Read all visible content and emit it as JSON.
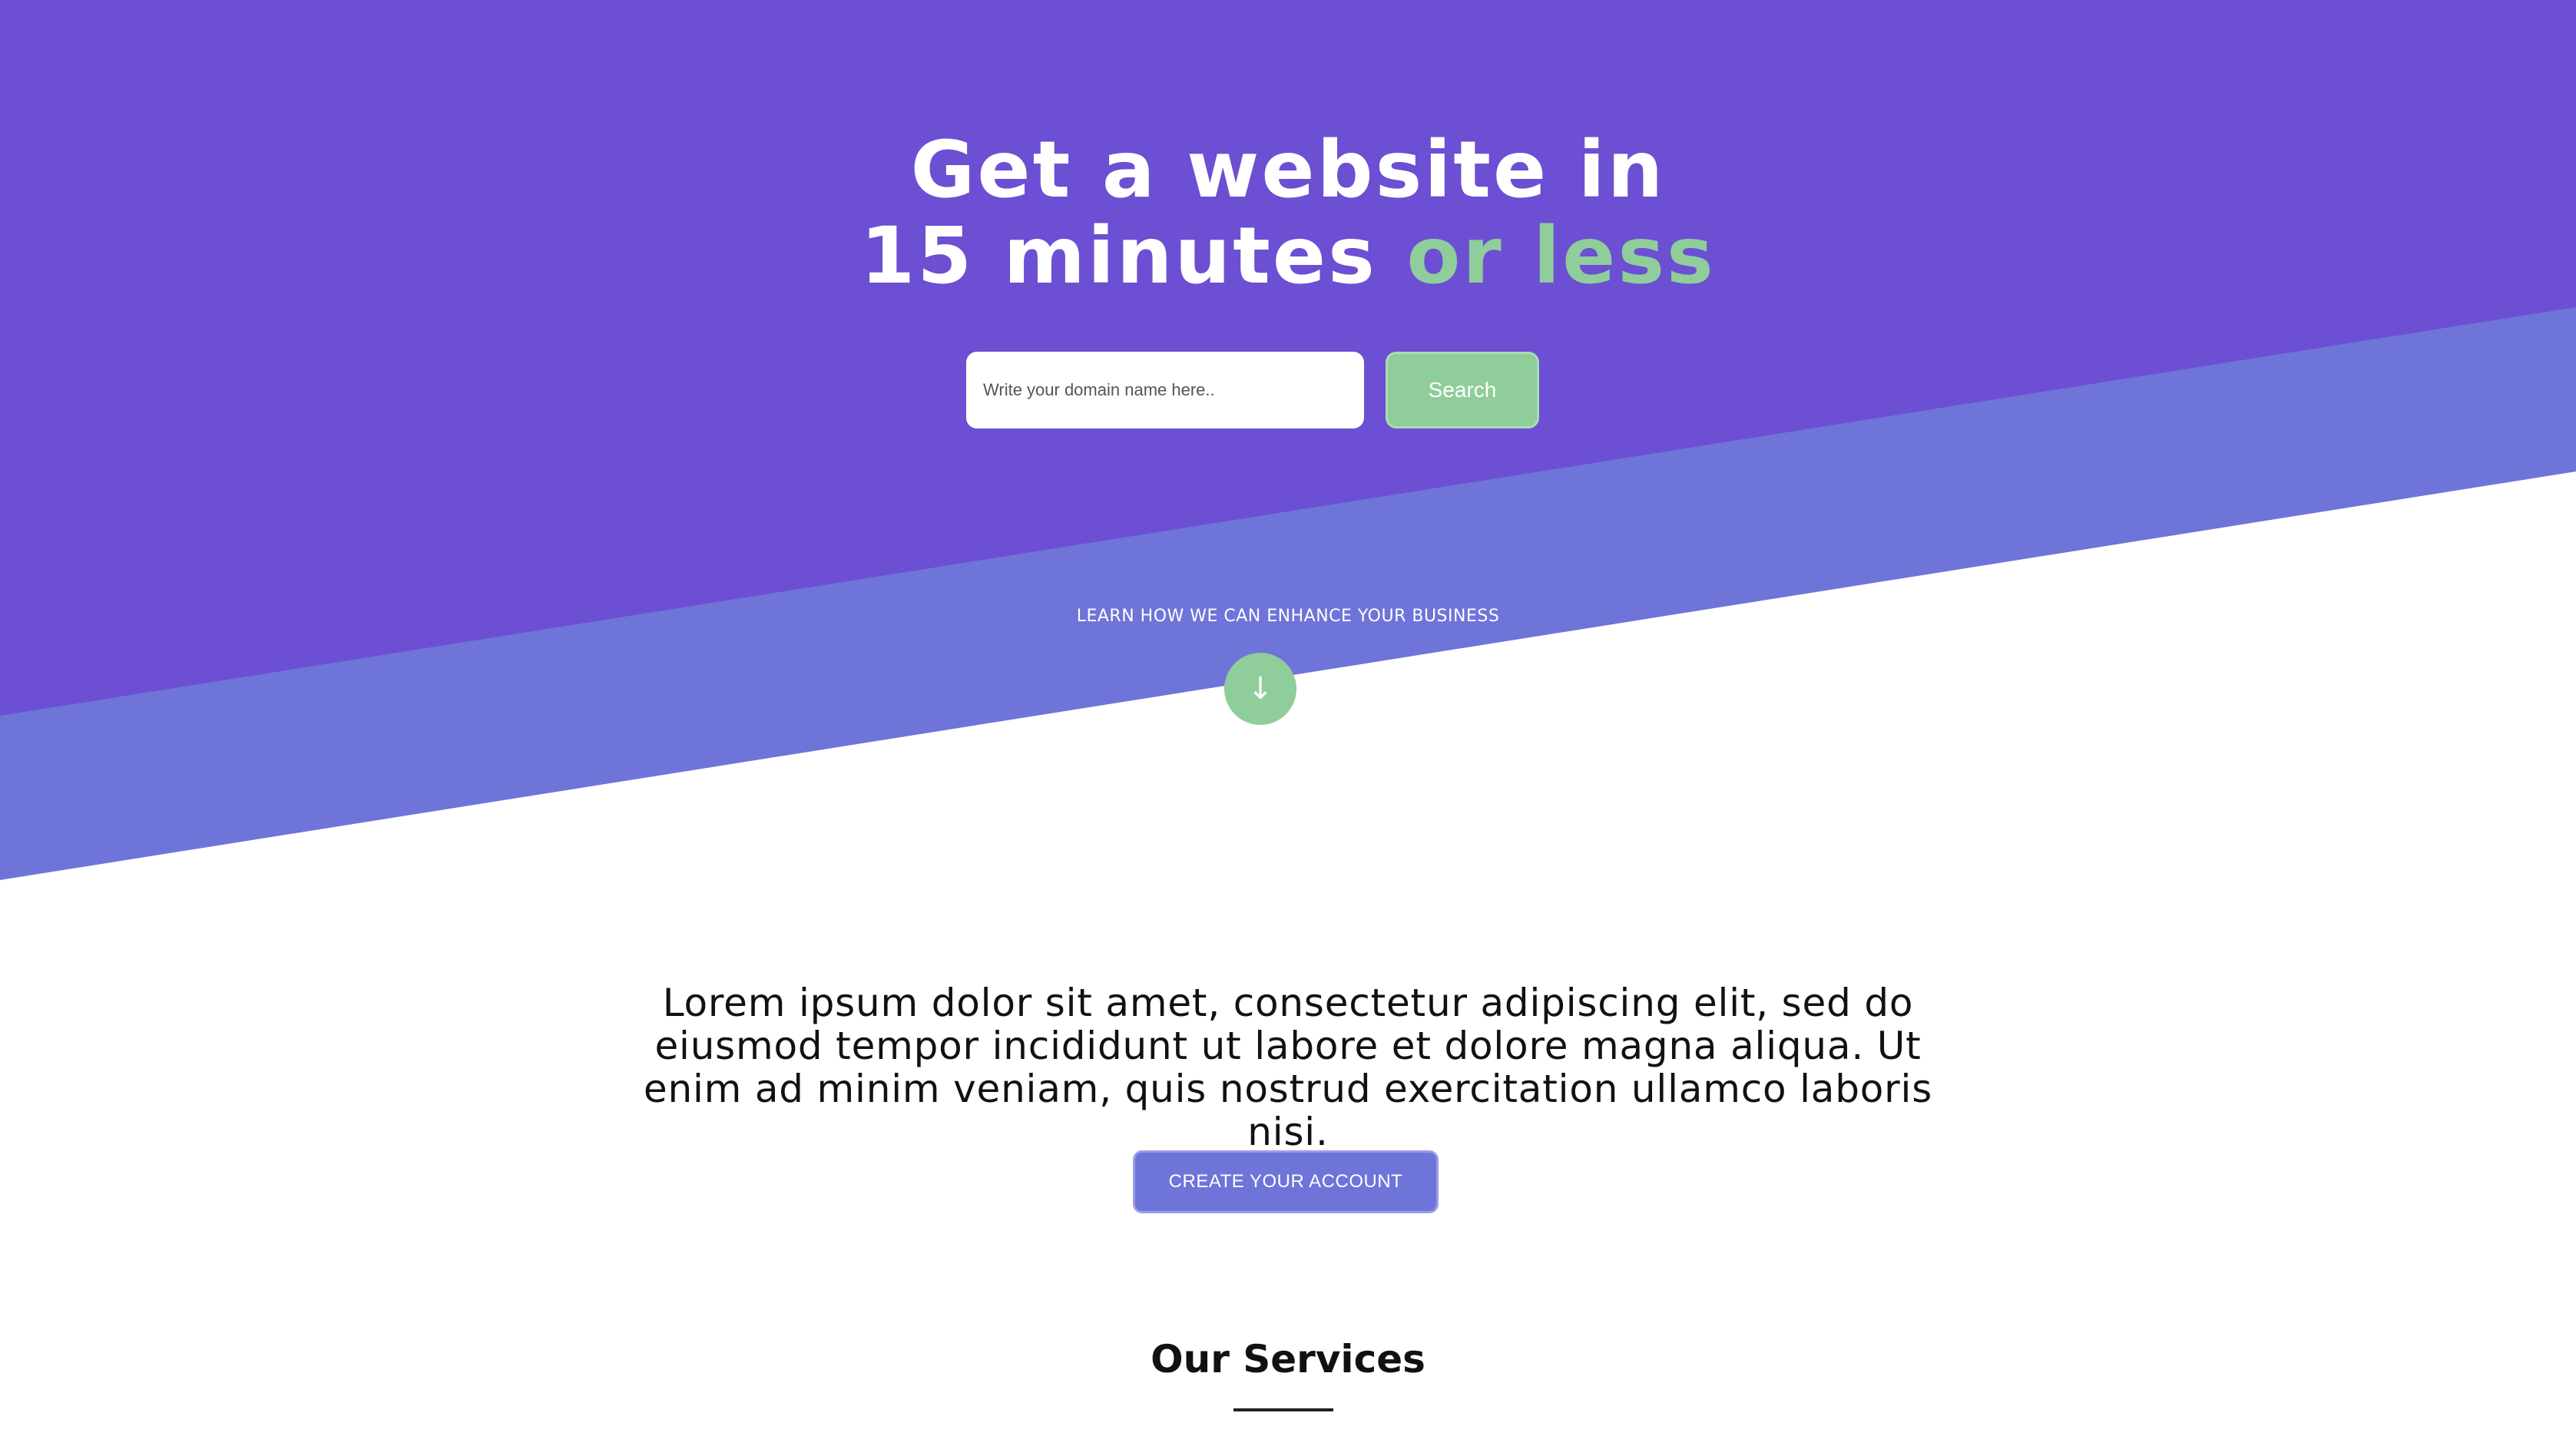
{
  "colors": {
    "hero_purple": "#6c4fd2",
    "band_periwinkle": "#6f74d9",
    "accent_green": "#8fcd9a",
    "page_background": "#ffffff",
    "text_dark": "#111111"
  },
  "hero": {
    "title_line1": "Get a website in",
    "title_line2_main": "15 minutes ",
    "title_line2_accent": "or less",
    "search": {
      "placeholder": "Write your domain name here..",
      "value": "",
      "button_label": "Search"
    },
    "learn_more_label": "LEARN HOW WE CAN ENHANCE YOUR BUSINESS",
    "scroll_button_icon": "down-arrow-icon",
    "scroll_button_glyph": "↓"
  },
  "intro": {
    "text": "Lorem ipsum dolor sit amet, consectetur adipiscing elit, sed do eiusmod tempor incididunt ut labore et dolore magna aliqua. Ut enim ad minim veniam, quis nostrud exercitation ullamco laboris nisi.",
    "cta_label": "CREATE YOUR ACCOUNT"
  },
  "services": {
    "heading": "Our Services"
  }
}
